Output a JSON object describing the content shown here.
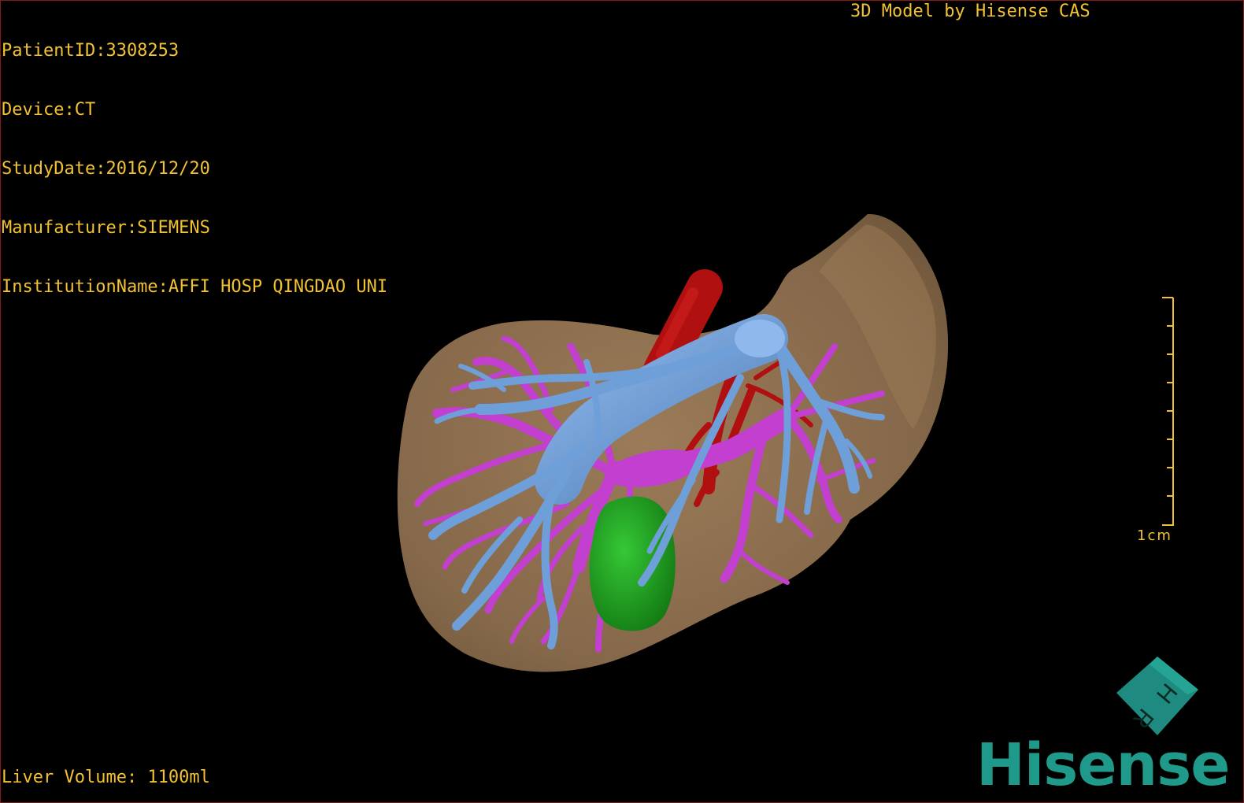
{
  "info": {
    "patient_id": "PatientID:3308253",
    "device": "Device:CT",
    "study_date": "StudyDate:2016/12/20",
    "manufacturer": "Manufacturer:SIEMENS",
    "institution": "InstitutionName:AFFI HOSP QINGDAO UNI"
  },
  "credit": "3D Model by Hisense CAS",
  "volume": "Liver Volume: 1100ml",
  "scale": {
    "label": "1cm"
  },
  "orientation_cube": {
    "letters": [
      "H",
      "R"
    ]
  },
  "logo": {
    "text": "Hisense"
  },
  "colors": {
    "text": "#f2c230",
    "liver": "#8b6e4e",
    "portal_vein": "#c23fd0",
    "hepatic_vein": "#6f9fd8",
    "artery": "#b01010",
    "gallbladder": "#1fa51f",
    "logo": "#1f9a8a"
  },
  "icons": [
    "orientation-cube-icon",
    "scale-bar-icon"
  ]
}
